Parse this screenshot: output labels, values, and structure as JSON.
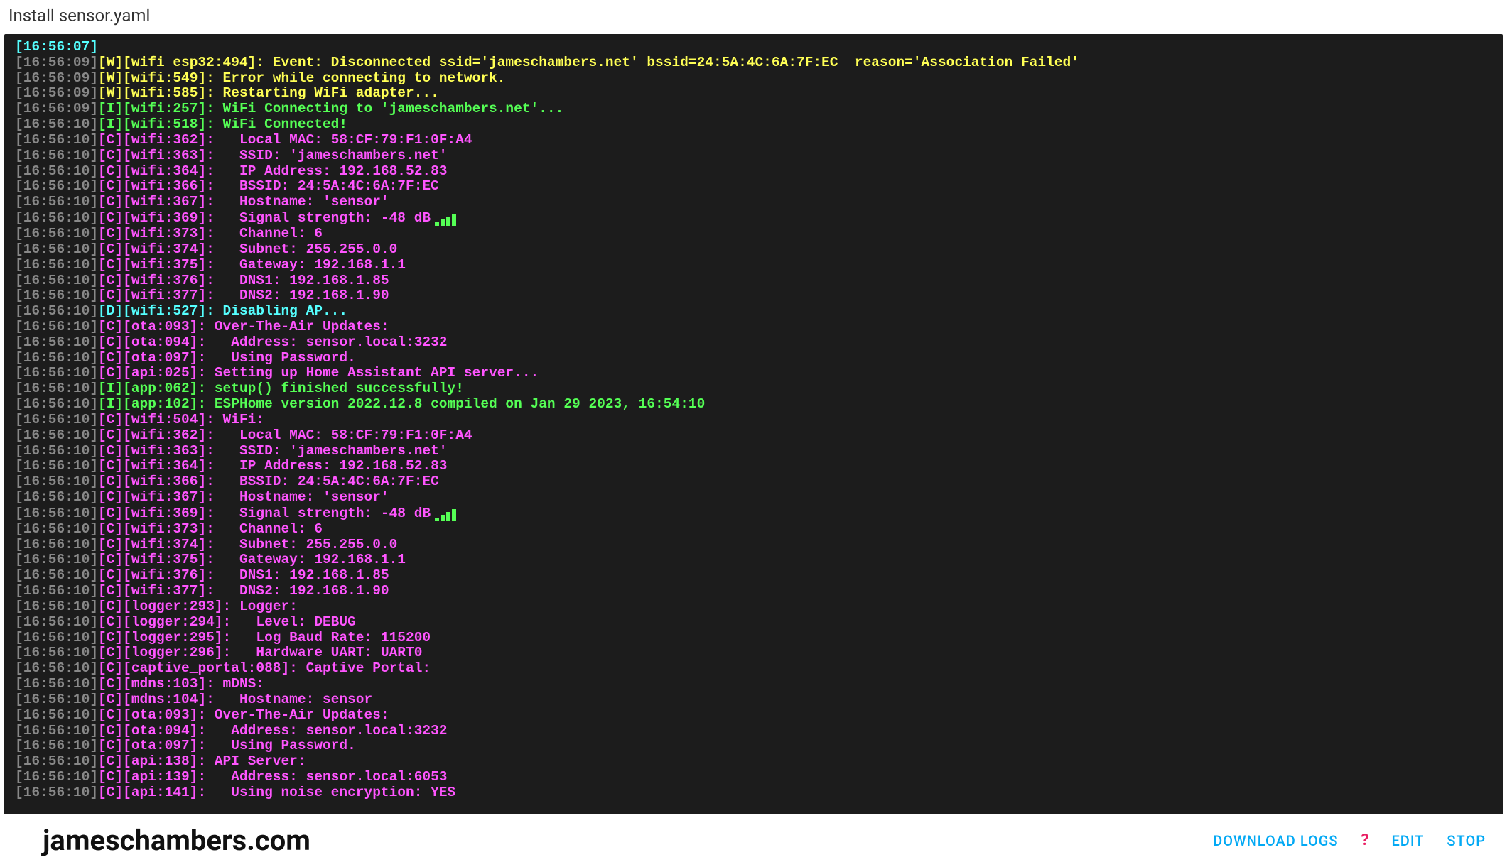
{
  "header": {
    "title": "Install sensor.yaml"
  },
  "footer": {
    "brand": "jameschambers.com",
    "download": "DOWNLOAD LOGS",
    "help": "?",
    "edit": "EDIT",
    "stop": "STOP"
  },
  "log": [
    {
      "ts": "[16:56:07]",
      "lvl": "",
      "msg": ""
    },
    {
      "ts": "[16:56:09]",
      "lvl": "W",
      "tag": "[wifi_esp32:494]",
      "msg": "Event: Disconnected ssid='jameschambers.net' bssid=24:5A:4C:6A:7F:EC  reason='Association Failed'"
    },
    {
      "ts": "[16:56:09]",
      "lvl": "W",
      "tag": "[wifi:549]",
      "msg": "Error while connecting to network."
    },
    {
      "ts": "[16:56:09]",
      "lvl": "W",
      "tag": "[wifi:585]",
      "msg": "Restarting WiFi adapter..."
    },
    {
      "ts": "[16:56:09]",
      "lvl": "I",
      "tag": "[wifi:257]",
      "msg": "WiFi Connecting to 'jameschambers.net'..."
    },
    {
      "ts": "[16:56:10]",
      "lvl": "I",
      "tag": "[wifi:518]",
      "msg": "WiFi Connected!"
    },
    {
      "ts": "[16:56:10]",
      "lvl": "C",
      "tag": "[wifi:362]",
      "msg": "  Local MAC: 58:CF:79:F1:0F:A4"
    },
    {
      "ts": "[16:56:10]",
      "lvl": "C",
      "tag": "[wifi:363]",
      "msg": "  SSID: 'jameschambers.net'"
    },
    {
      "ts": "[16:56:10]",
      "lvl": "C",
      "tag": "[wifi:364]",
      "msg": "  IP Address: 192.168.52.83"
    },
    {
      "ts": "[16:56:10]",
      "lvl": "C",
      "tag": "[wifi:366]",
      "msg": "  BSSID: 24:5A:4C:6A:7F:EC"
    },
    {
      "ts": "[16:56:10]",
      "lvl": "C",
      "tag": "[wifi:367]",
      "msg": "  Hostname: 'sensor'"
    },
    {
      "ts": "[16:56:10]",
      "lvl": "C",
      "tag": "[wifi:369]",
      "msg": "  Signal strength: -48 dB",
      "signal": true
    },
    {
      "ts": "[16:56:10]",
      "lvl": "C",
      "tag": "[wifi:373]",
      "msg": "  Channel: 6"
    },
    {
      "ts": "[16:56:10]",
      "lvl": "C",
      "tag": "[wifi:374]",
      "msg": "  Subnet: 255.255.0.0"
    },
    {
      "ts": "[16:56:10]",
      "lvl": "C",
      "tag": "[wifi:375]",
      "msg": "  Gateway: 192.168.1.1"
    },
    {
      "ts": "[16:56:10]",
      "lvl": "C",
      "tag": "[wifi:376]",
      "msg": "  DNS1: 192.168.1.85"
    },
    {
      "ts": "[16:56:10]",
      "lvl": "C",
      "tag": "[wifi:377]",
      "msg": "  DNS2: 192.168.1.90"
    },
    {
      "ts": "[16:56:10]",
      "lvl": "D",
      "tag": "[wifi:527]",
      "msg": "Disabling AP..."
    },
    {
      "ts": "[16:56:10]",
      "lvl": "C",
      "tag": "[ota:093]",
      "msg": "Over-The-Air Updates:"
    },
    {
      "ts": "[16:56:10]",
      "lvl": "C",
      "tag": "[ota:094]",
      "msg": "  Address: sensor.local:3232"
    },
    {
      "ts": "[16:56:10]",
      "lvl": "C",
      "tag": "[ota:097]",
      "msg": "  Using Password."
    },
    {
      "ts": "[16:56:10]",
      "lvl": "C",
      "tag": "[api:025]",
      "msg": "Setting up Home Assistant API server..."
    },
    {
      "ts": "[16:56:10]",
      "lvl": "I",
      "tag": "[app:062]",
      "msg": "setup() finished successfully!"
    },
    {
      "ts": "[16:56:10]",
      "lvl": "I",
      "tag": "[app:102]",
      "msg": "ESPHome version 2022.12.8 compiled on Jan 29 2023, 16:54:10"
    },
    {
      "ts": "[16:56:10]",
      "lvl": "C",
      "tag": "[wifi:504]",
      "msg": "WiFi:"
    },
    {
      "ts": "[16:56:10]",
      "lvl": "C",
      "tag": "[wifi:362]",
      "msg": "  Local MAC: 58:CF:79:F1:0F:A4"
    },
    {
      "ts": "[16:56:10]",
      "lvl": "C",
      "tag": "[wifi:363]",
      "msg": "  SSID: 'jameschambers.net'"
    },
    {
      "ts": "[16:56:10]",
      "lvl": "C",
      "tag": "[wifi:364]",
      "msg": "  IP Address: 192.168.52.83"
    },
    {
      "ts": "[16:56:10]",
      "lvl": "C",
      "tag": "[wifi:366]",
      "msg": "  BSSID: 24:5A:4C:6A:7F:EC"
    },
    {
      "ts": "[16:56:10]",
      "lvl": "C",
      "tag": "[wifi:367]",
      "msg": "  Hostname: 'sensor'"
    },
    {
      "ts": "[16:56:10]",
      "lvl": "C",
      "tag": "[wifi:369]",
      "msg": "  Signal strength: -48 dB",
      "signal": true
    },
    {
      "ts": "[16:56:10]",
      "lvl": "C",
      "tag": "[wifi:373]",
      "msg": "  Channel: 6"
    },
    {
      "ts": "[16:56:10]",
      "lvl": "C",
      "tag": "[wifi:374]",
      "msg": "  Subnet: 255.255.0.0"
    },
    {
      "ts": "[16:56:10]",
      "lvl": "C",
      "tag": "[wifi:375]",
      "msg": "  Gateway: 192.168.1.1"
    },
    {
      "ts": "[16:56:10]",
      "lvl": "C",
      "tag": "[wifi:376]",
      "msg": "  DNS1: 192.168.1.85"
    },
    {
      "ts": "[16:56:10]",
      "lvl": "C",
      "tag": "[wifi:377]",
      "msg": "  DNS2: 192.168.1.90"
    },
    {
      "ts": "[16:56:10]",
      "lvl": "C",
      "tag": "[logger:293]",
      "msg": "Logger:"
    },
    {
      "ts": "[16:56:10]",
      "lvl": "C",
      "tag": "[logger:294]",
      "msg": "  Level: DEBUG"
    },
    {
      "ts": "[16:56:10]",
      "lvl": "C",
      "tag": "[logger:295]",
      "msg": "  Log Baud Rate: 115200"
    },
    {
      "ts": "[16:56:10]",
      "lvl": "C",
      "tag": "[logger:296]",
      "msg": "  Hardware UART: UART0"
    },
    {
      "ts": "[16:56:10]",
      "lvl": "C",
      "tag": "[captive_portal:088]",
      "msg": "Captive Portal:"
    },
    {
      "ts": "[16:56:10]",
      "lvl": "C",
      "tag": "[mdns:103]",
      "msg": "mDNS:"
    },
    {
      "ts": "[16:56:10]",
      "lvl": "C",
      "tag": "[mdns:104]",
      "msg": "  Hostname: sensor"
    },
    {
      "ts": "[16:56:10]",
      "lvl": "C",
      "tag": "[ota:093]",
      "msg": "Over-The-Air Updates:"
    },
    {
      "ts": "[16:56:10]",
      "lvl": "C",
      "tag": "[ota:094]",
      "msg": "  Address: sensor.local:3232"
    },
    {
      "ts": "[16:56:10]",
      "lvl": "C",
      "tag": "[ota:097]",
      "msg": "  Using Password."
    },
    {
      "ts": "[16:56:10]",
      "lvl": "C",
      "tag": "[api:138]",
      "msg": "API Server:"
    },
    {
      "ts": "[16:56:10]",
      "lvl": "C",
      "tag": "[api:139]",
      "msg": "  Address: sensor.local:6053"
    },
    {
      "ts": "[16:56:10]",
      "lvl": "C",
      "tag": "[api:141]",
      "msg": "  Using noise encryption: YES"
    }
  ]
}
